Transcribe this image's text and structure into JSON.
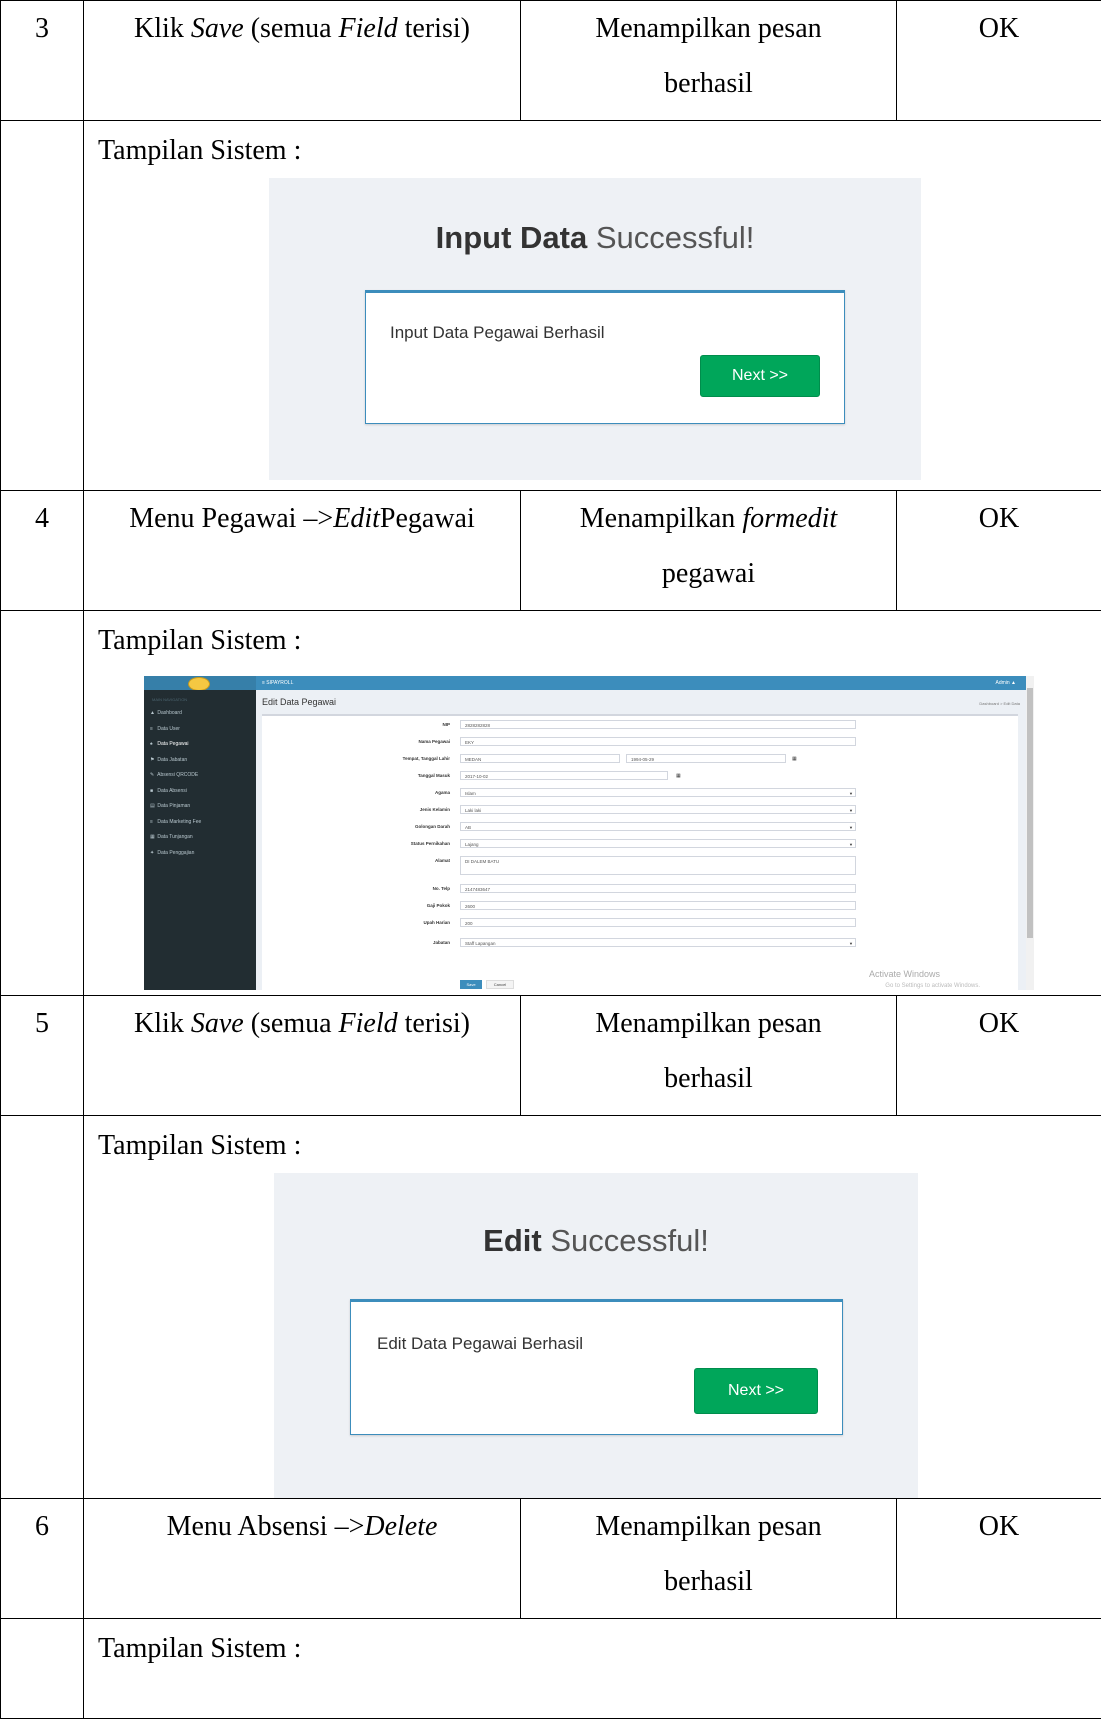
{
  "rows": [
    {
      "no": "3",
      "step_plain_1": "Klik ",
      "step_italic_1": "Save",
      "step_plain_2": " (semua ",
      "step_italic_2": "Field",
      "step_plain_3": " terisi)",
      "expected_line1": "Menampilkan pesan",
      "expected_line2": "berhasil",
      "result": "OK",
      "screen_label": "Tampilan Sistem :",
      "screen": {
        "title_bold": "Input Data",
        "title_light": " Successful!",
        "message": "Input Data Pegawai Berhasil",
        "button": "Next >>"
      }
    },
    {
      "no": "4",
      "step_plain_1": "Menu Pegawai –>",
      "step_italic_1": "Edit",
      "step_plain_2": "Pegawai",
      "expected_line1_plain": "Menampilkan ",
      "expected_line1_italic": "formedit",
      "expected_line2": "pegawai",
      "result": "OK",
      "screen_label": "Tampilan Sistem :",
      "app": {
        "brand": "≡ SIPAYROLL",
        "admin": "Admin ▲",
        "sidebar_head": "MAIN NAVIGATION",
        "menu": [
          {
            "icon": "▲",
            "label": "Dashboard"
          },
          {
            "icon": "≡",
            "label": "Data User"
          },
          {
            "icon": "♠",
            "label": "Data Pegawai"
          },
          {
            "icon": "⚑",
            "label": "Data Jabatan"
          },
          {
            "icon": "✎",
            "label": "Absensi QRCODE"
          },
          {
            "icon": "■",
            "label": "Data Absensi"
          },
          {
            "icon": "▤",
            "label": "Data Pinjaman"
          },
          {
            "icon": "≡",
            "label": "Data Marketing Fee"
          },
          {
            "icon": "▦",
            "label": "Data Tunjangan"
          },
          {
            "icon": "✦",
            "label": "Data Penggajian"
          }
        ],
        "page_title": "Edit Data Pegawai",
        "breadcrumb": "Dashboard > Edit Data",
        "fields": {
          "nip_label": "NIP",
          "nip": "2828282828",
          "nama_label": "Nama Pegawai",
          "nama": "EKY",
          "ttl_label": "Tempat, Tanggal Lahir",
          "tempat": "MEDAN",
          "tanggal": "1994-05-29",
          "masuk_label": "Tanggal Masuk",
          "masuk": "2017-10-02",
          "agama_label": "Agama",
          "agama": "Islam",
          "jk_label": "Jenis Kelamin",
          "jk": "Laki laki",
          "goldar_label": "Golongan Darah",
          "goldar": "AB",
          "status_label": "Status Pernikahan",
          "status": "Lajang",
          "alamat_label": "Alamat",
          "alamat": "DI DALEM BATU",
          "telp_label": "No. Telp",
          "telp": "2147483647",
          "gaji_label": "Gaji Pokok",
          "gaji": "2600",
          "upah_label": "Upah Harian",
          "upah": "200",
          "jabatan_label": "Jabatan",
          "jabatan": "Staff Lapangan"
        },
        "save": "Save",
        "cancel": "Cancel",
        "watermark1": "Activate Windows",
        "watermark2": "Go to Settings to activate Windows."
      }
    },
    {
      "no": "5",
      "step_plain_1": "Klik ",
      "step_italic_1": "Save",
      "step_plain_2": " (semua ",
      "step_italic_2": "Field",
      "step_plain_3": " terisi)",
      "expected_line1": "Menampilkan pesan",
      "expected_line2": "berhasil",
      "result": "OK",
      "screen_label": "Tampilan Sistem :",
      "screen": {
        "title_bold": "Edit",
        "title_light": " Successful!",
        "message": "Edit Data Pegawai Berhasil",
        "button": "Next >>"
      }
    },
    {
      "no": "6",
      "step_plain_1": "Menu Absensi –>",
      "step_italic_1": "Delete",
      "expected_line1": "Menampilkan pesan",
      "expected_line2": "berhasil",
      "result": "OK",
      "screen_label": "Tampilan Sistem :"
    }
  ]
}
